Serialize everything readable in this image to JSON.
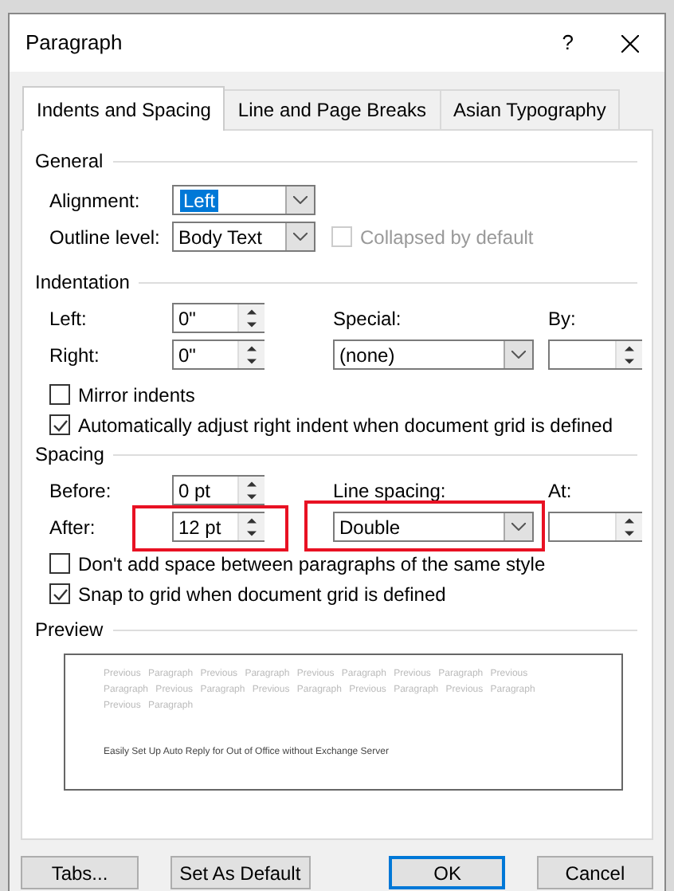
{
  "window": {
    "title": "Paragraph",
    "help": "?"
  },
  "tabs": [
    {
      "label": "Indents and Spacing",
      "selected": true
    },
    {
      "label": "Line and Page Breaks",
      "selected": false
    },
    {
      "label": "Asian Typography",
      "selected": false
    }
  ],
  "general": {
    "heading": "General",
    "alignment": {
      "label": "Alignment:",
      "value": "Left",
      "focused": true
    },
    "outline_level": {
      "label": "Outline level:",
      "value": "Body Text",
      "focused": false
    },
    "collapsed": {
      "label": "Collapsed by default",
      "checked": false,
      "disabled": true
    }
  },
  "indentation": {
    "heading": "Indentation",
    "left": {
      "label": "Left:",
      "value": "0\""
    },
    "right": {
      "label": "Right:",
      "value": "0\""
    },
    "special": {
      "label": "Special:",
      "value": "(none)"
    },
    "by": {
      "label": "By:"
    },
    "mirror_indents": {
      "label": "Mirror indents",
      "checked": false,
      "disabled": false
    },
    "auto_adjust": {
      "label": "Automatically adjust right indent when document grid is defined",
      "checked": true,
      "disabled": false
    }
  },
  "spacing": {
    "heading": "Spacing",
    "before": {
      "label": "Before:",
      "value": "0 pt",
      "highlighted": false
    },
    "after": {
      "label": "After:",
      "value": "12 pt",
      "highlighted": true
    },
    "line_spacing": {
      "label": "Line spacing:",
      "value": "Double",
      "highlighted": true
    },
    "at": {
      "label": "At:"
    },
    "dont_add": {
      "label": "Don't add space between paragraphs of the same style",
      "checked": false,
      "disabled": false
    },
    "snap": {
      "label": "Snap to grid when document grid is defined",
      "checked": true,
      "disabled": false
    }
  },
  "preview": {
    "heading": "Preview",
    "previous_lines": [
      "Previous Paragraph Previous Paragraph Previous Paragraph Previous Paragraph Previous",
      "Paragraph Previous Paragraph Previous Paragraph Previous Paragraph Previous Paragraph",
      "Previous Paragraph"
    ],
    "sample": "Easily Set Up Auto Reply for Out of Office without Exchange Server"
  },
  "buttons": [
    {
      "label": "Tabs...",
      "default": false
    },
    {
      "label": "Set As Default",
      "default": false
    },
    {
      "label": "OK",
      "default": true
    },
    {
      "label": "Cancel",
      "default": false
    }
  ]
}
